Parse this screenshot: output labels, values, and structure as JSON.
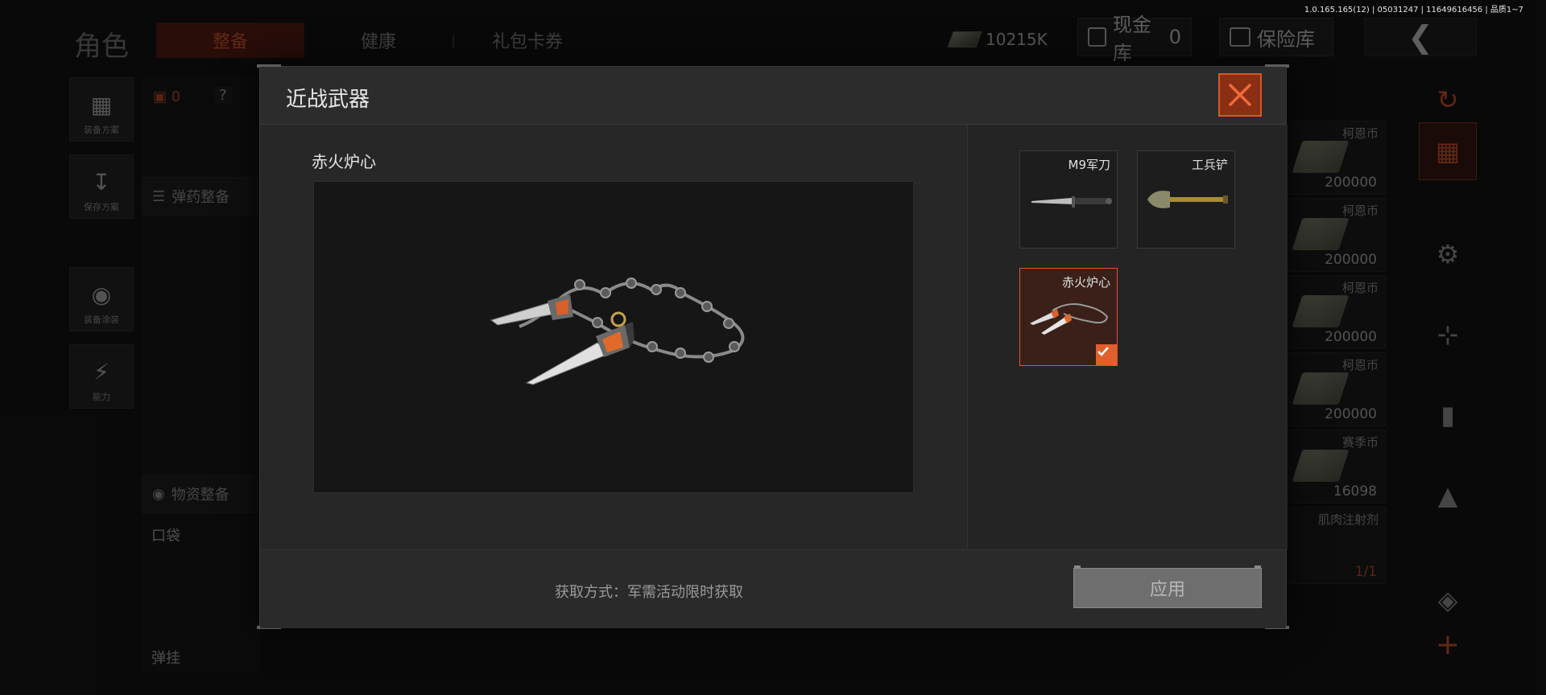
{
  "version_text": "1.0.165.165(12) | 05031247 | 11649616456 | 品质1~7",
  "topbar": {
    "title": "角色",
    "tabs": [
      {
        "label": "整备",
        "active": true
      },
      {
        "label": "健康",
        "active": false
      },
      {
        "label": "礼包卡券",
        "active": false
      }
    ],
    "currency_amount": "10215K",
    "cash_vault_label": "现金库",
    "cash_vault_count": "0",
    "insurance_label": "保险库"
  },
  "left_nav": [
    {
      "label": "装备方案",
      "icon": "backpack-icon"
    },
    {
      "label": "保存方案",
      "icon": "download-icon"
    },
    {
      "label": "装备涂装",
      "icon": "helmet-icon"
    },
    {
      "label": "能力",
      "icon": "energy-icon"
    }
  ],
  "left_panel": {
    "armor_count": "0",
    "help": "?",
    "ammo_label": "弹药整备",
    "supply_label": "物资整备",
    "pocket_label": "口袋",
    "mag_label": "弹挂"
  },
  "right_panel": {
    "cells": [
      {
        "name": "柯恩币",
        "value": "200000"
      },
      {
        "name": "柯恩币",
        "value": "200000"
      },
      {
        "name": "柯恩币",
        "value": "200000"
      },
      {
        "name": "柯恩币",
        "value": "200000"
      },
      {
        "name": "赛季币",
        "value": "16098"
      },
      {
        "name": "肌肉注射剂",
        "value": "1/1"
      }
    ],
    "partial_left": [
      "币",
      "000",
      "000",
      "000",
      "000",
      "000",
      "射剂",
      "1/1"
    ]
  },
  "modal": {
    "title": "近战武器",
    "selected_item_name": "赤火炉心",
    "skins": [
      {
        "name": "M9军刀",
        "selected": false,
        "icon": "bayonet-icon"
      },
      {
        "name": "工兵铲",
        "selected": false,
        "icon": "shovel-icon"
      },
      {
        "name": "赤火炉心",
        "selected": true,
        "icon": "chain-blade-icon"
      }
    ],
    "acquire_text": "获取方式：军需活动限时获取",
    "apply_label": "应用"
  },
  "colors": {
    "accent": "#d9572e",
    "accent_dark": "#8a2e14",
    "panel": "#262626"
  }
}
